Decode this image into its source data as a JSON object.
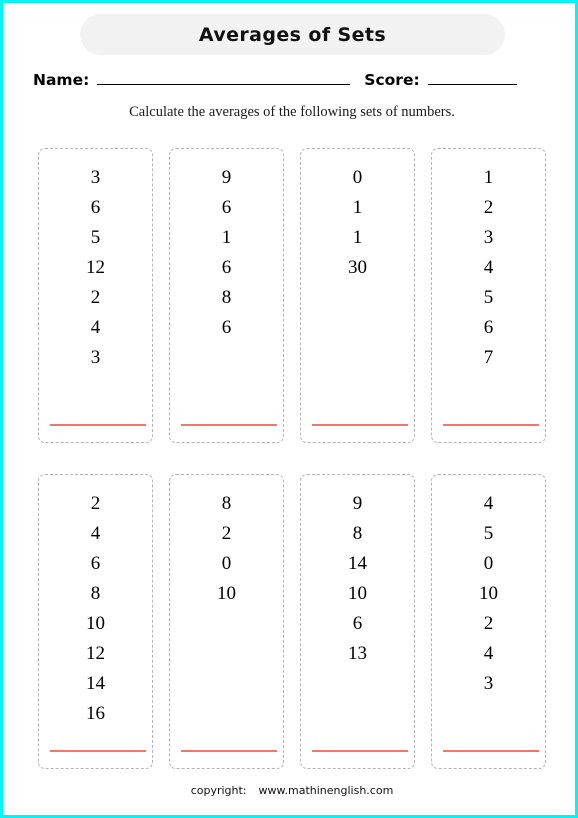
{
  "page": {
    "border_color": "#00f5f5",
    "background": "#ffffff"
  },
  "header": {
    "title": "Averages of Sets",
    "title_pill_color": "#f2f2f2"
  },
  "fields": {
    "name_label": "Name:",
    "name_value": "",
    "score_label": "Score:",
    "score_value": ""
  },
  "instruction": "Calculate the averages of the following sets of numbers.",
  "answer_line_color": "#f4756b",
  "box_border_color": "#b4b4b4",
  "sets": [
    {
      "id": 1,
      "numbers": [
        "3",
        "6",
        "5",
        "12",
        "2",
        "4",
        "3"
      ],
      "answer": ""
    },
    {
      "id": 2,
      "numbers": [
        "9",
        "6",
        "1",
        "6",
        "8",
        "6"
      ],
      "answer": ""
    },
    {
      "id": 3,
      "numbers": [
        "0",
        "1",
        "1",
        "30"
      ],
      "answer": ""
    },
    {
      "id": 4,
      "numbers": [
        "1",
        "2",
        "3",
        "4",
        "5",
        "6",
        "7"
      ],
      "answer": ""
    },
    {
      "id": 5,
      "numbers": [
        "2",
        "4",
        "6",
        "8",
        "10",
        "12",
        "14",
        "16"
      ],
      "answer": ""
    },
    {
      "id": 6,
      "numbers": [
        "8",
        "2",
        "0",
        "10"
      ],
      "answer": ""
    },
    {
      "id": 7,
      "numbers": [
        "9",
        "8",
        "14",
        "10",
        "6",
        "13"
      ],
      "answer": ""
    },
    {
      "id": 8,
      "numbers": [
        "4",
        "5",
        "0",
        "10",
        "2",
        "4",
        "3"
      ],
      "answer": ""
    }
  ],
  "footer": {
    "copyright_label": "copyright:",
    "site": "www.mathinenglish.com"
  }
}
